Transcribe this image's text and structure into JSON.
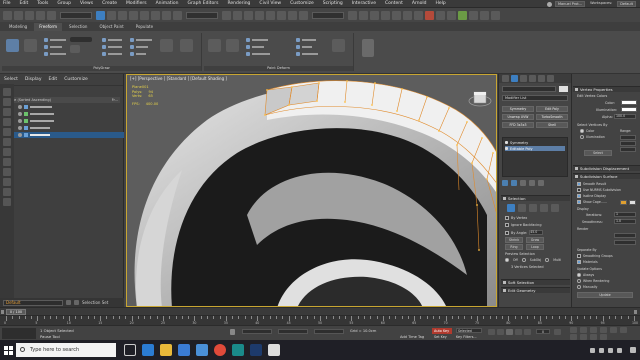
{
  "menu": {
    "items": [
      "File",
      "Edit",
      "Tools",
      "Group",
      "Views",
      "Create",
      "Modifiers",
      "Animation",
      "Graph Editors",
      "Rendering",
      "Civil View",
      "Customize",
      "Scripting",
      "Interactive",
      "Content",
      "Arnold",
      "Help"
    ],
    "account": "Manuel Prot...",
    "workspace_label": "Workspaces:",
    "workspace_value": "Default"
  },
  "ribbon": {
    "tabs": [
      "Modeling",
      "Freeform",
      "Selection",
      "Object Paint",
      "Populate"
    ],
    "active_tab": "Freeform",
    "group_polydraw": "PolyDraw",
    "group_paint": "Paint Deform",
    "polydraw_tools": [
      "Drag",
      "Conform",
      "Step Build",
      "Extend",
      "Optimize",
      "Draw On",
      "Shapes",
      "Splines",
      "Surface",
      "Topology",
      "Strips",
      "Tris",
      "Branches",
      "Solve Surface",
      "Pinch",
      "Relax/Soften",
      "Flatten",
      "Noise",
      "Smudge",
      "Exaggerate",
      "Revert"
    ],
    "paint_tools": [
      "Shift",
      "Push/Pull",
      "Relax",
      "Pinch/Spread",
      "Paint",
      "Use Selected Verts"
    ]
  },
  "explorer": {
    "tabs": [
      "Select",
      "Display",
      "Edit",
      "Customize"
    ],
    "sort_header": "Name (Sorted Ascending)",
    "frozen_header": "Fr...",
    "rows": [
      "Plane001",
      "Group20514",
      "Group20481",
      "Plane002",
      "Plane003"
    ],
    "layer_value": "Default",
    "selection_set_label": "Selection Set"
  },
  "viewport": {
    "label": "[+] [Perspective ] [Standard ] [Default Shading ]",
    "stats": {
      "object": "Plane001",
      "polys_label": "Polys:",
      "polys": "94",
      "verts_label": "Verts:",
      "verts": "65",
      "fps_label": "FPS:",
      "fps": "400.00"
    }
  },
  "command_panel": {
    "object_name": "",
    "modifier_list": "Modifier List",
    "buttons": [
      "Symmetry",
      "Edit Poly",
      "Unwrap UVW",
      "TurboSmooth",
      "FFD 3x3x3",
      "Shell"
    ],
    "stack": [
      "Symmetry",
      "Editable Poly"
    ],
    "selection_header": "Selection",
    "by_vertex": "By Vertex",
    "ignore_backfacing": "Ignore Backfacing",
    "by_angle": "By Angle:",
    "by_angle_value": "45.0",
    "shrink": "Shrink",
    "grow": "Grow",
    "ring": "Ring",
    "loop": "Loop",
    "preview_selection": "Preview Selection",
    "preview_opts": [
      "Off",
      "SubObj",
      "Multi"
    ],
    "selected_status": "3 Vertices Selected",
    "soft_selection": "Soft Selection",
    "edit_geometry": "Edit Geometry"
  },
  "rollout": {
    "vertex_properties": "Vertex Properties",
    "edit_vertex_colors": "Edit Vertex Colors",
    "color_label": "Color:",
    "illumination_label": "Illumination:",
    "alpha_label": "Alpha:",
    "alpha_value": "100.0",
    "select_vertices_by": "Select Vertices By",
    "opt_color": "Color",
    "opt_illumination": "Illumination",
    "range_label": "Range:",
    "select_btn": "Select",
    "subdivision_displacement": "Subdivision Displacement",
    "subdivision_surface": "Subdivision Surface",
    "smooth_result": "Smooth Result",
    "use_nurms": "Use NURMS Subdivision",
    "isoline_display": "Isoline Display",
    "show_cage": "Show Cage......",
    "display_label": "Display",
    "iterations_label": "Iterations:",
    "iterations_value": "1",
    "smoothness_label": "Smoothness:",
    "smoothness_value": "1.0",
    "render_label": "Render",
    "separate_by": "Separate By",
    "smoothing_groups": "Smoothing Groups",
    "materials": "Materials",
    "update_options": "Update Options",
    "update_always": "Always",
    "update_when_rendering": "When Rendering",
    "update_manually": "Manually",
    "update_btn": "Update"
  },
  "timeline": {
    "slider": "0 / 100",
    "ticks": [
      "0",
      "5",
      "10",
      "15",
      "20",
      "25",
      "30",
      "35",
      "40",
      "45",
      "50",
      "55",
      "60",
      "65",
      "70",
      "75",
      "80",
      "85",
      "90",
      "95",
      "100"
    ]
  },
  "status": {
    "line1": "1 Object Selected",
    "line2": "Pause Tool",
    "auto_key": "Auto Key",
    "set_key": "Set Key",
    "selected": "Selected",
    "key_filters": "Key Filters...",
    "add_time_tag": "Add Time Tag",
    "grid": "Grid = 10.0cm",
    "frame": "0"
  },
  "taskbar": {
    "search_placeholder": "Type here to search",
    "apps": [
      "task-view",
      "edge",
      "file-explorer",
      "store",
      "mail",
      "chrome",
      "3dsmax",
      "photoshop",
      "unity"
    ],
    "clock_time": "",
    "clock_date": ""
  },
  "colors": {
    "viewport_border": "#c8a632",
    "selection_blue": "#2a5a8a",
    "stats_yellow": "#e6d24a",
    "edge_orange": "#e08a2a",
    "accent_blue": "#3d7fc1"
  }
}
